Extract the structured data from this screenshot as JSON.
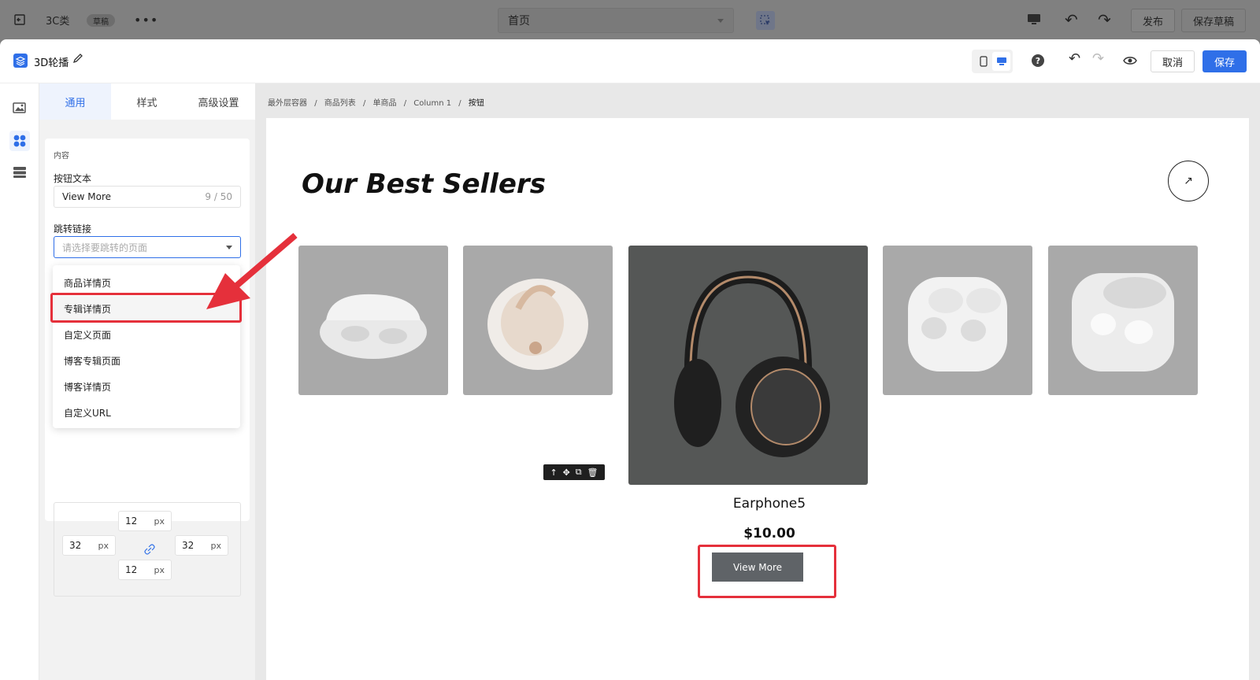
{
  "topbar": {
    "project": "3C类",
    "badge": "草稿",
    "more": "•••",
    "page_select": "首页",
    "publish": "发布",
    "save_draft": "保存草稿"
  },
  "header": {
    "title": "3D轮播",
    "help": "?",
    "cancel": "取消",
    "save": "保存"
  },
  "tabs": [
    "通用",
    "样式",
    "高级设置"
  ],
  "content": {
    "section_label": "内容",
    "button_text_label": "按钮文本",
    "button_text_value": "View More",
    "button_text_count": "9 / 50",
    "link_label": "跳转链接",
    "link_placeholder": "请选择要跳转的页面"
  },
  "dropdown_options": [
    "商品详情页",
    "专辑详情页",
    "自定义页面",
    "博客专辑页面",
    "博客详情页",
    "自定义URL"
  ],
  "spacing": {
    "top": "12",
    "left": "32",
    "right": "32",
    "bottom": "12",
    "unit": "px"
  },
  "breadcrumb": [
    "最外层容器",
    "商品列表",
    "单商品",
    "Column 1",
    "按钮"
  ],
  "breadcrumb_sep": "/",
  "canvas": {
    "heading": "Our Best Sellers",
    "product_title": "Earphone5",
    "product_price": "$10.00",
    "button_label": "View More",
    "arrow": "↗"
  }
}
